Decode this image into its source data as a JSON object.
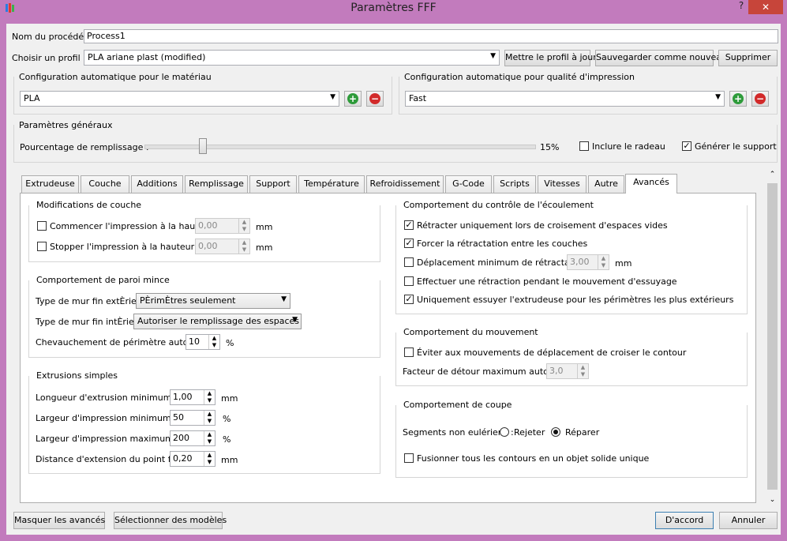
{
  "window": {
    "title": "Paramètres FFF",
    "help": "?",
    "close": "✕"
  },
  "header": {
    "process_label": "Nom du procédé :",
    "process_value": "Process1",
    "profile_label": "Choisir un profil :",
    "profile_value": "PLA ariane plast (modified)",
    "update_profile": "Mettre le profil à jour",
    "save_new": "Sauvegarder comme nouveau",
    "delete": "Supprimer"
  },
  "auto_material": {
    "title": "Configuration automatique pour le matériau",
    "value": "PLA"
  },
  "auto_quality": {
    "title": "Configuration automatique pour qualité d'impression",
    "value": "Fast"
  },
  "general": {
    "title": "Paramètres généraux",
    "infill_label": "Pourcentage de remplissage :",
    "infill_value": "15%",
    "infill_fraction": 0.15,
    "raft_label": "Inclure le radeau",
    "raft_checked": false,
    "support_label": "Générer le support",
    "support_checked": true
  },
  "tabs": [
    "Extrudeuse",
    "Couche",
    "Additions",
    "Remplissage",
    "Support",
    "Température",
    "Refroidissement",
    "G-Code",
    "Scripts",
    "Vitesses",
    "Autre",
    "Avancés"
  ],
  "active_tab": "Avancés",
  "layer_mods": {
    "title": "Modifications de couche",
    "start_label": "Commencer l'impression à la hauteur",
    "start_value": "0,00",
    "stop_label": "Stopper  l'impression à la hauteur",
    "stop_value": "0,00",
    "unit": "mm"
  },
  "thin_wall": {
    "title": "Comportement de paroi mince",
    "outer_label": "Type de mur fin extÈrieur",
    "outer_value": "PÈrimÈtres seulement",
    "inner_label": "Type de mur fin intÈrieur",
    "inner_value": "Autoriser le remplissage des espaces",
    "overlap_label": "Chevauchement de périmètre autorisé",
    "overlap_value": "10",
    "overlap_unit": "%"
  },
  "single_extr": {
    "title": "Extrusions simples",
    "rows": [
      {
        "label": "Longueur d'extrusion minimum",
        "value": "1,00",
        "unit": "mm"
      },
      {
        "label": "Largeur d'impression minimum",
        "value": "50",
        "unit": "%"
      },
      {
        "label": "Largeur d'impression maximum",
        "value": "200",
        "unit": "%"
      },
      {
        "label": "Distance d'extension du point final",
        "value": "0,20",
        "unit": "mm"
      }
    ]
  },
  "flow": {
    "title": "Comportement du contrôle de l'écoulement",
    "r1": "Rétracter uniquement lors de croisement d'espaces vides",
    "r2": "Forcer la rétractation entre les couches",
    "r3": "Déplacement minimum de rétractation",
    "r3_value": "3,00",
    "r3_unit": "mm",
    "r4": "Effectuer une rétraction pendant le mouvement d'essuyage",
    "r5": "Uniquement essuyer l'extrudeuse pour les périmètres les plus extérieurs"
  },
  "movement": {
    "title": "Comportement du mouvement",
    "avoid_label": "Éviter aux mouvements de déplacement de croiser le contour",
    "detour_label": "Facteur de détour maximum autorisé",
    "detour_value": "3,0"
  },
  "cutting": {
    "title": "Comportement de coupe",
    "segments_label": "Segments non eulériens :",
    "reject": "Rejeter",
    "repair": "Réparer",
    "merge_label": "Fusionner tous les contours en un objet solide unique"
  },
  "footer": {
    "hide_advanced": "Masquer les avancés",
    "select_models": "Sélectionner des modèles",
    "ok": "D'accord",
    "cancel": "Annuler"
  }
}
